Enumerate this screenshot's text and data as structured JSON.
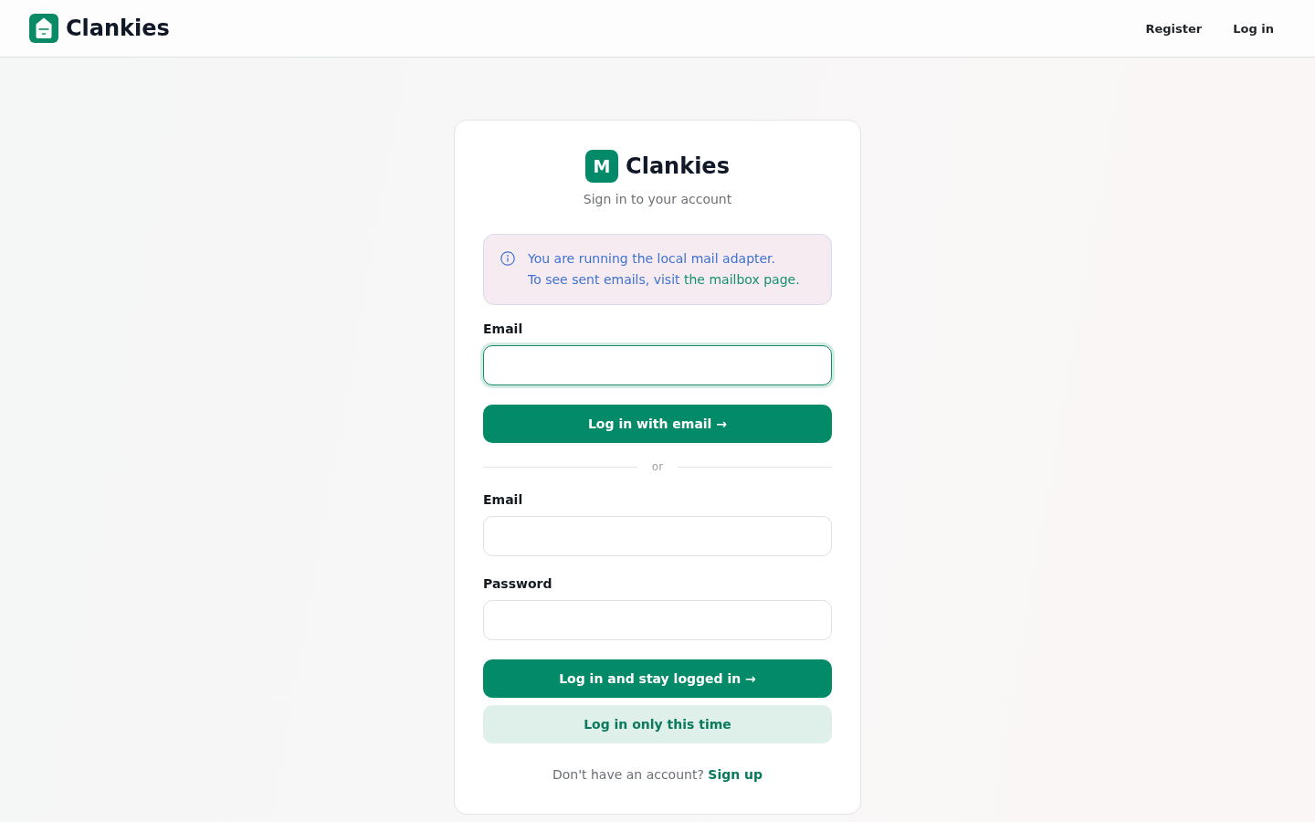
{
  "header": {
    "brand": "Clankies",
    "nav": [
      {
        "label": "Register"
      },
      {
        "label": "Log in"
      }
    ]
  },
  "login_card": {
    "logo_letter": "M",
    "title": "Clankies",
    "subtitle": "Sign in to your account",
    "notice": {
      "lines": [
        {
          "text": "You are running the local mail adapter."
        },
        {
          "text": "To see sent emails, visit ",
          "link": "the mailbox page."
        }
      ]
    },
    "email_login": {
      "fields": [
        {
          "label": "Email",
          "focused": true
        }
      ],
      "buttons": [
        {
          "label": "Log in with email →",
          "kind": "primary"
        }
      ]
    },
    "divider": "or",
    "password_login": {
      "fields": [
        {
          "label": "Email",
          "focused": false
        },
        {
          "label": "Password",
          "focused": false
        }
      ],
      "buttons": [
        {
          "label": "Log in and stay logged in →",
          "kind": "primary"
        },
        {
          "label": "Log in only this time",
          "kind": "secondary"
        }
      ]
    },
    "signup_prompt": {
      "text": "Don't have an account? ",
      "link": "Sign up"
    }
  }
}
